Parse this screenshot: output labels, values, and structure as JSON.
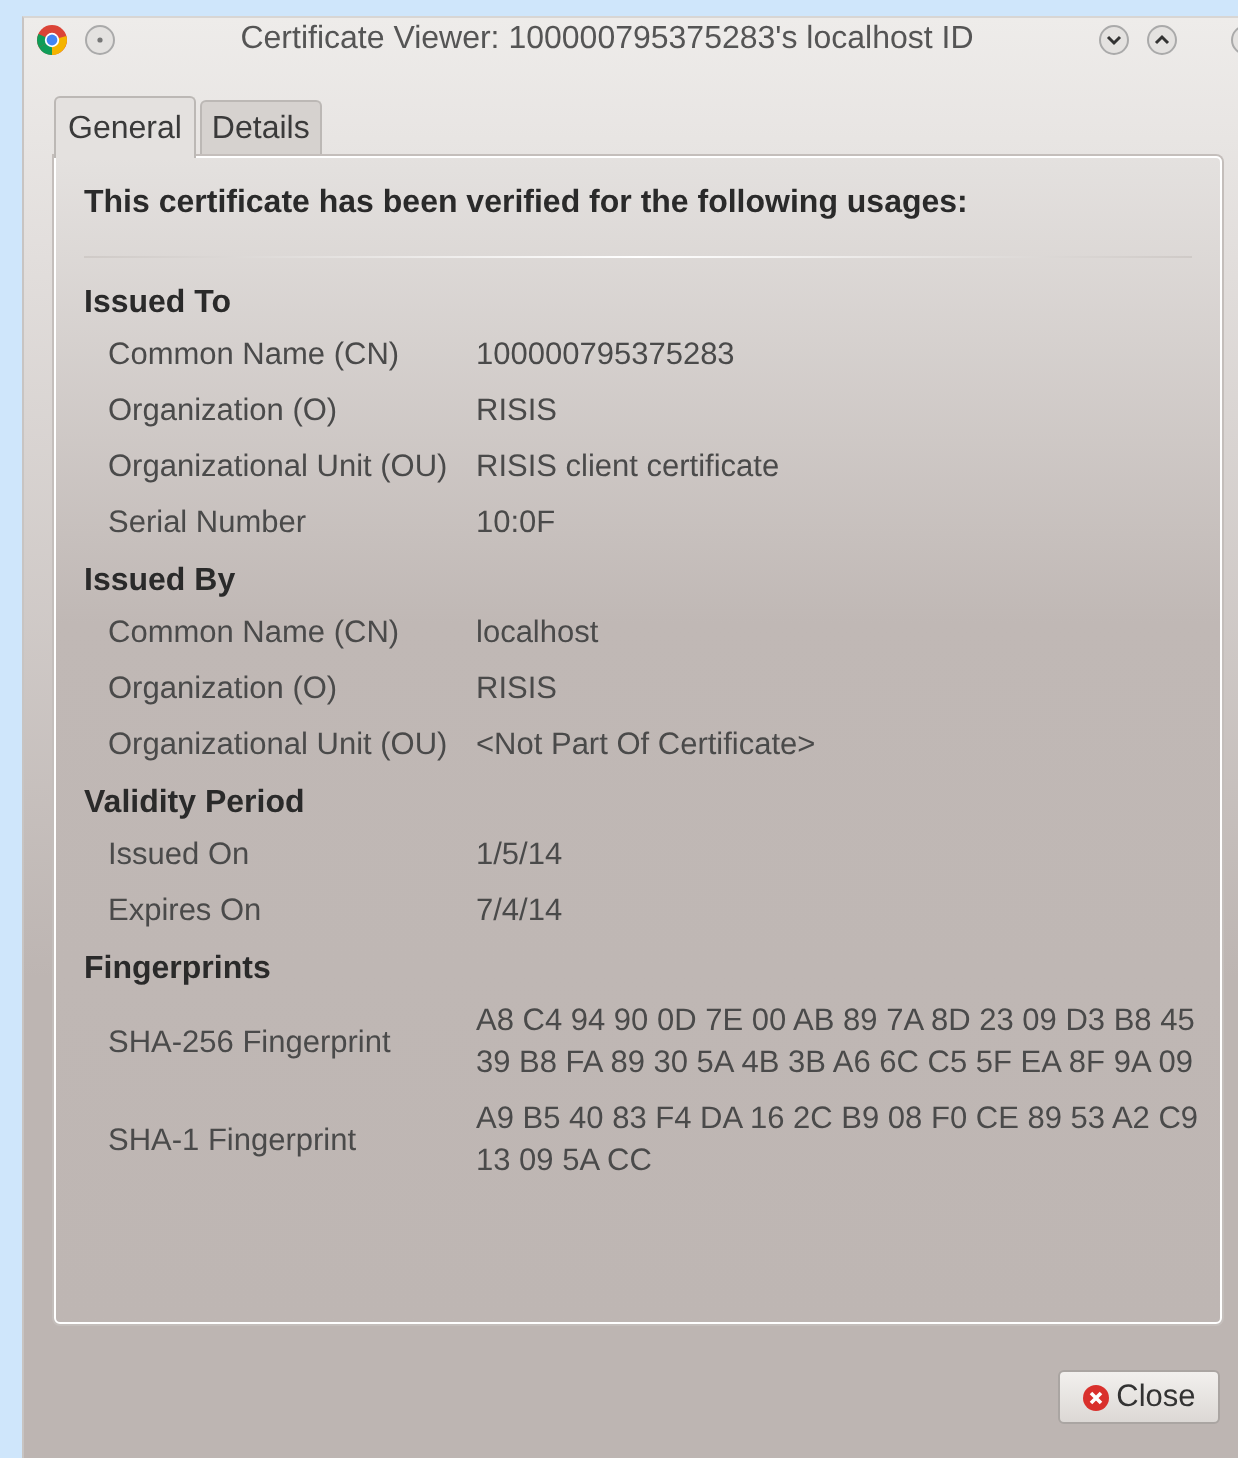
{
  "window": {
    "title": "Certificate Viewer: 100000795375283's localhost ID"
  },
  "tabs": [
    {
      "label": "General",
      "selected": true
    },
    {
      "label": "Details",
      "selected": false
    }
  ],
  "heading": "This certificate has been verified for the following usages:",
  "sections": [
    {
      "title": "Issued To",
      "fields": [
        {
          "label": "Common Name (CN)",
          "value": "100000795375283"
        },
        {
          "label": "Organization (O)",
          "value": "RISIS"
        },
        {
          "label": "Organizational Unit (OU)",
          "value": "RISIS client certificate"
        },
        {
          "label": "Serial Number",
          "value": "10:0F"
        }
      ]
    },
    {
      "title": "Issued By",
      "fields": [
        {
          "label": "Common Name (CN)",
          "value": "localhost"
        },
        {
          "label": "Organization (O)",
          "value": "RISIS"
        },
        {
          "label": "Organizational Unit (OU)",
          "value": "<Not Part Of Certificate>"
        }
      ]
    },
    {
      "title": "Validity Period",
      "fields": [
        {
          "label": "Issued On",
          "value": "1/5/14"
        },
        {
          "label": "Expires On",
          "value": "7/4/14"
        }
      ]
    },
    {
      "title": "Fingerprints",
      "fields": [
        {
          "label": "SHA-256 Fingerprint",
          "value": "A8 C4 94 90 0D 7E 00 AB 89 7A 8D 23 09 D3 B8 45 39 B8 FA 89 30 5A 4B 3B A6 6C C5 5F EA 8F 9A 09"
        },
        {
          "label": "SHA-1 Fingerprint",
          "value": "A9 B5 40 83 F4 DA 16 2C B9 08 F0 CE 89 53 A2 C9 13 09 5A CC"
        }
      ]
    }
  ],
  "buttons": [
    {
      "label": "Close",
      "kind": "close"
    }
  ]
}
